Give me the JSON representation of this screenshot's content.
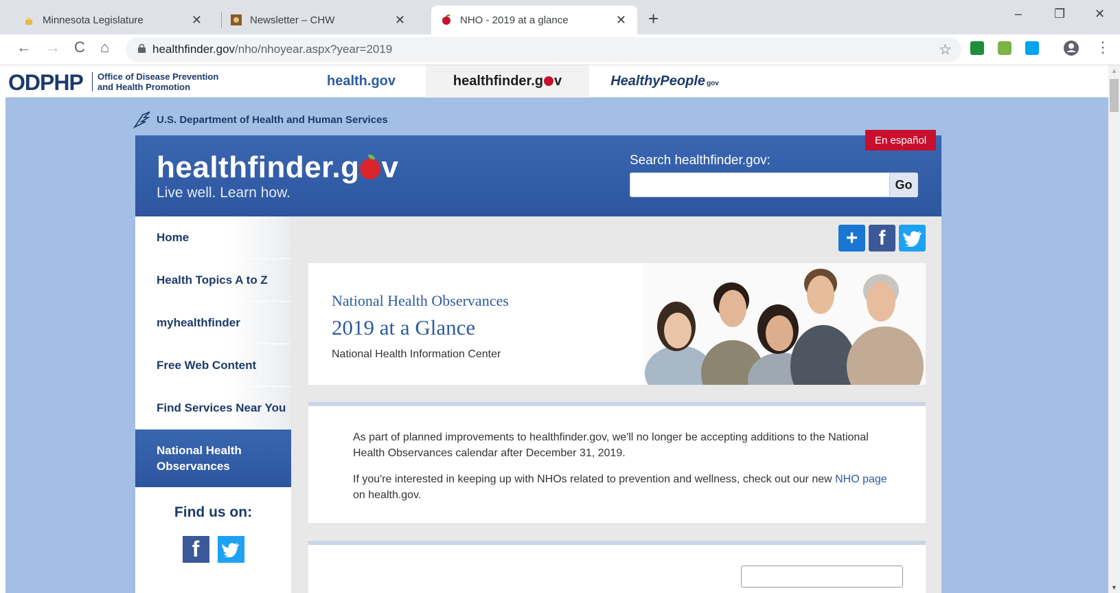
{
  "browser": {
    "tabs": [
      {
        "title": "Minnesota Legislature",
        "active": false
      },
      {
        "title": "Newsletter – CHW",
        "active": false
      },
      {
        "title": "NHO - 2019 at a glance",
        "active": true
      }
    ],
    "new_tab": "+",
    "close_glyph": "✕",
    "window_controls": {
      "minimize": "–",
      "restore": "❐",
      "close": "✕"
    },
    "nav": {
      "back": "←",
      "forward": "→",
      "reload": "C",
      "home": "⌂"
    },
    "url_host": "healthfinder.gov",
    "url_path": "/nho/nhoyear.aspx?year=2019",
    "bookmark_star": "☆",
    "profile": "👤",
    "menu": "⋮"
  },
  "odphp": {
    "logo": "ODPHP",
    "subtitle_line1": "Office of Disease Prevention",
    "subtitle_line2": "and Health Promotion",
    "tabs": {
      "health": "health.gov",
      "healthfinder_pre": "healthfinder.g",
      "healthfinder_post": "v",
      "healthypeople": "HealthyPeople",
      "healthypeople_suffix": "gov"
    }
  },
  "hhs": {
    "label": "U.S. Department of Health and Human Services"
  },
  "header": {
    "brand_pre": "healthfinder.g",
    "brand_post": "v",
    "tagline": "Live well. Learn how.",
    "search_label": "Search healthfinder.gov:",
    "search_value": "",
    "go_label": "Go",
    "espanol": "En español"
  },
  "sidebar": {
    "items": [
      {
        "label": "Home"
      },
      {
        "label": "Health Topics A to Z"
      },
      {
        "label": "myhealthfinder"
      },
      {
        "label": "Free Web Content"
      },
      {
        "label": "Find Services Near You"
      },
      {
        "label": "National Health Observances",
        "active": true
      }
    ],
    "find_us": "Find us on:",
    "facebook_glyph": "f",
    "twitter_glyph": "🐦"
  },
  "share": {
    "plus": "+",
    "facebook": "f",
    "twitter": "🐦"
  },
  "hero": {
    "kicker": "National Health Observances",
    "title": "2019 at a Glance",
    "subtitle": "National Health Information Center"
  },
  "notice": {
    "p1": "As part of planned improvements to healthfinder.gov, we'll no longer be accepting additions to the National Health Observances calendar after December 31, 2019.",
    "p2_before": "If you're interested in keeping up with NHOs related to prevention and wellness, check out our new ",
    "p2_link": "NHO page",
    "p2_after": " on health.gov."
  },
  "colors": {
    "page_bg": "#a3bfe5",
    "header_blue": "#2d569f",
    "link_blue": "#2c5b9e",
    "espanol_red": "#c8102e"
  }
}
